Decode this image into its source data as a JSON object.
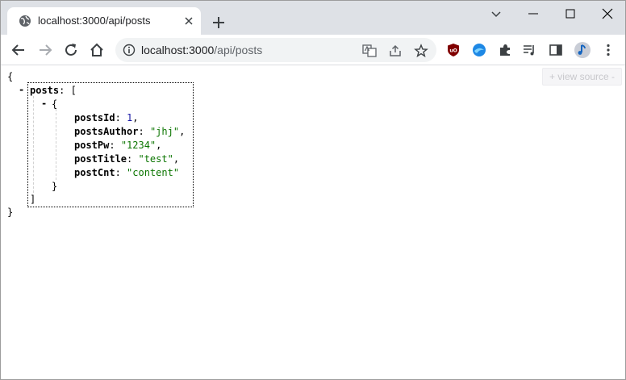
{
  "tab": {
    "title": "localhost:3000/api/posts"
  },
  "address": {
    "host": "localhost:3000",
    "path": "/api/posts"
  },
  "viewer": {
    "view_source_label": "+  view source  -",
    "open_brace": "{",
    "close_brace": "}",
    "array_key": "posts",
    "open_bracket": "[",
    "close_bracket": "]",
    "object_open": "{",
    "object_close": "}",
    "collapse_symbol": "-",
    "fields": [
      {
        "key": "postsId",
        "value": "1",
        "type": "number"
      },
      {
        "key": "postsAuthor",
        "value": "\"jhj\"",
        "type": "string"
      },
      {
        "key": "postPw",
        "value": "\"1234\"",
        "type": "string"
      },
      {
        "key": "postTitle",
        "value": "\"test\"",
        "type": "string"
      },
      {
        "key": "postCnt",
        "value": "\"content\"",
        "type": "string"
      }
    ]
  },
  "icons": {
    "favicon": "globe-icon",
    "extensions": [
      "ublock-icon",
      "edge-icon",
      "puzzle-icon",
      "media-icon",
      "sidepanel-icon",
      "profile-icon",
      "menu-icon"
    ]
  },
  "colors": {
    "number": "#1a1aa6",
    "string": "#0b7500",
    "tabstrip": "#dee1e6"
  }
}
